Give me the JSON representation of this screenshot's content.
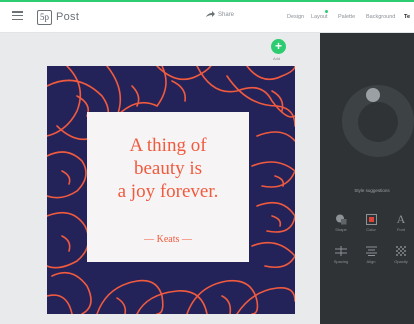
{
  "header": {
    "logo_box": "5p",
    "logo_text": "Post",
    "share_label": "Share",
    "nav": [
      "Design",
      "Layout",
      "Palette",
      "Background",
      "Te"
    ]
  },
  "canvas": {
    "add_label": "Add",
    "quote_lines": [
      "A thing of",
      "beauty is",
      "a joy forever."
    ],
    "author": "— Keats —"
  },
  "panel": {
    "style_label": "Style suggestions",
    "tools_row1": [
      "Shape",
      "Color",
      "Font"
    ],
    "tools_row2": [
      "Spacing",
      "Align",
      "Opacity"
    ]
  },
  "colors": {
    "accent": "#2ecc71",
    "design_bg": "#23235a",
    "flower": "#f05a3e",
    "panel_bg": "#2f3336"
  }
}
